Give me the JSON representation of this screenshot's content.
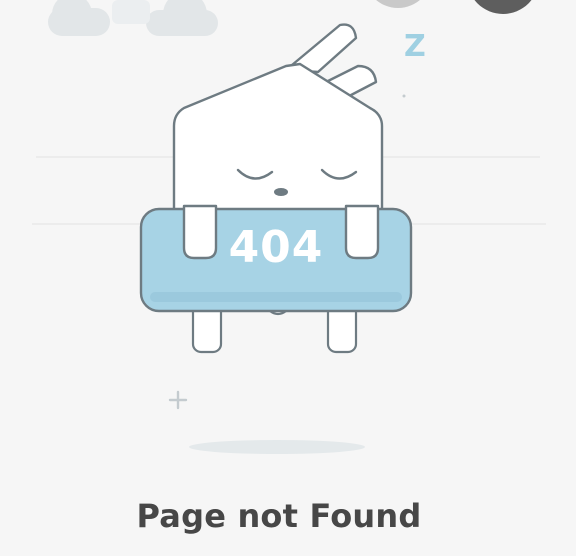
{
  "illustration": {
    "error_code": "404",
    "sleep_letter": "Z"
  },
  "message": {
    "title": "Page not Found"
  },
  "colors": {
    "background": "#f6f6f6",
    "plate_blue": "#a7d3e5",
    "outline": "#6e7b82",
    "title_text": "#474747"
  }
}
